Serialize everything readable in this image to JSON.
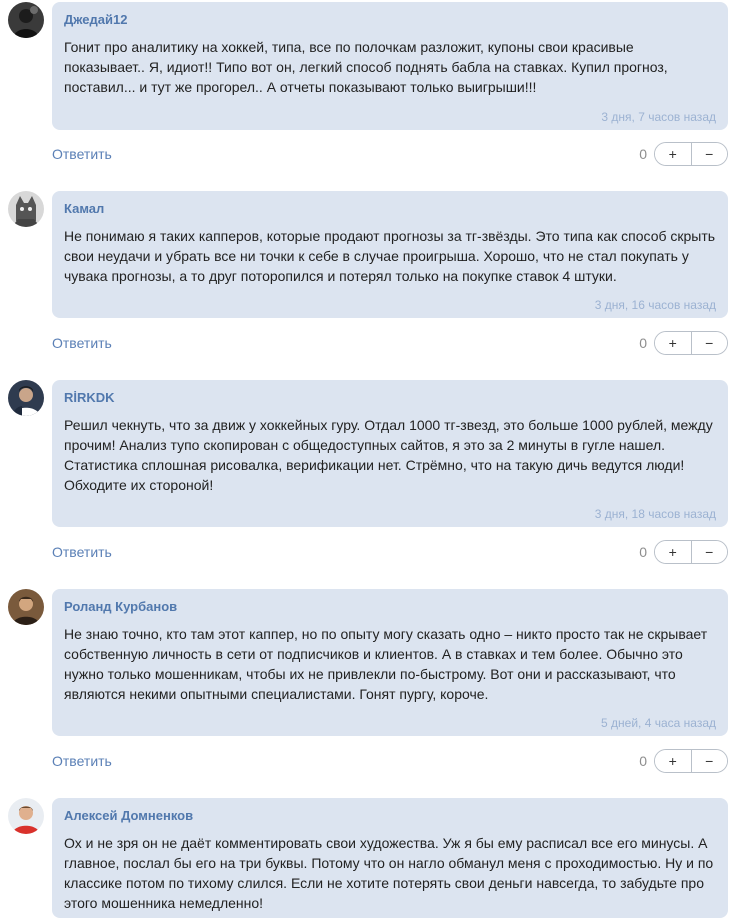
{
  "comments": [
    {
      "author": "Джедай12",
      "text": "Гонит про аналитику на хоккей, типа, все по полочкам разложит, купоны свои красивые показывает.. Я, идиот!! Типо вот он, легкий способ поднять бабла на ставках. Купил прогноз, поставил... и тут же прогорел.. А отчеты показывают только выигрыши!!!",
      "time": "3 дня, 7 часов назад",
      "votes": "0",
      "avatar": "avatar-dark-figure-icon"
    },
    {
      "author": "Камал",
      "text": "Не понимаю я таких капперов, которые продают прогнозы за тг-звёзды. Это типа как способ скрыть свои неудачи и убрать все ни точки к себе в случае проигрыша. Хорошо, что не стал покупать у чувака прогнозы, а то друг поторопился и потерял только на покупке ставок 4 штуки.",
      "time": "3 дня, 16 часов назад",
      "votes": "0",
      "avatar": "avatar-cat-icon"
    },
    {
      "author": "RİRKDK",
      "text": "Решил чекнуть, что за движ у хоккейных гуру. Отдал 1000 тг-звезд, это больше 1000 рублей, между прочим! Анализ тупо скопирован с общедоступных сайтов, я это за 2 минуты в гугле нашел. Статистика сплошная рисовалка, верификации нет. Стрёмно, что на такую дичь ведутся люди! Обходите их стороной!",
      "time": "3 дня, 18 часов назад",
      "votes": "0",
      "avatar": "avatar-person-icon"
    },
    {
      "author": "Роланд Курбанов",
      "text": "Не знаю точно, кто там этот каппер, но по опыту могу сказать одно – никто просто так не скрывает собственную личность в сети от подписчиков и клиентов. А в ставках и тем более. Обычно это нужно только мошенникам, чтобы их не привлекли по-быстрому. Вот они и рассказывают, что являются некими опытными специалистами. Гонят пургу, короче.",
      "time": "5 дней, 4 часа назад",
      "votes": "0",
      "avatar": "avatar-person-brown-icon"
    },
    {
      "author": "Алексей Домненков",
      "text": "Ох и не зря он не даёт комментировать свои художества. Уж я бы ему расписал все его минусы. А главное, послал бы его на три буквы. Потому что он нагло обманул меня с проходимостью. Ну и по классике потом по тихому слился. Если не хотите потерять свои деньги навсегда, то забудьте про этого мошенника немедленно!",
      "time": "",
      "votes": "",
      "avatar": "avatar-person-red-shirt-icon"
    }
  ],
  "labels": {
    "reply": "Ответить",
    "plus": "+",
    "minus": "−"
  }
}
